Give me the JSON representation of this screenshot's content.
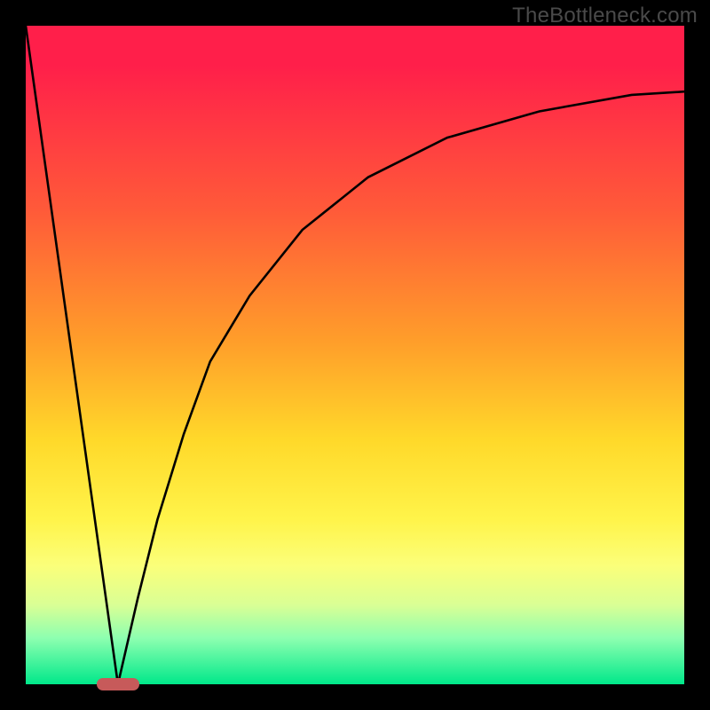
{
  "watermark": "TheBottleneck.com",
  "chart_data": {
    "type": "line",
    "title": "",
    "xlabel": "",
    "ylabel": "",
    "xlim": [
      0,
      100
    ],
    "ylim": [
      0,
      100
    ],
    "grid": false,
    "legend": false,
    "series": [
      {
        "name": "left-linear",
        "x": [
          0,
          14
        ],
        "values": [
          100,
          0
        ]
      },
      {
        "name": "right-curve",
        "x": [
          14,
          17,
          20,
          24,
          28,
          34,
          42,
          52,
          64,
          78,
          92,
          100
        ],
        "values": [
          0,
          13,
          25,
          38,
          49,
          59,
          69,
          77,
          83,
          87,
          89.5,
          90
        ]
      }
    ],
    "marker": {
      "x": 14,
      "y": 0,
      "color": "#c75a5a"
    },
    "gradient_stops": [
      {
        "pos": 0.0,
        "color": "#ff1f4a"
      },
      {
        "pos": 0.28,
        "color": "#ff5a39"
      },
      {
        "pos": 0.48,
        "color": "#ff9e2a"
      },
      {
        "pos": 0.63,
        "color": "#ffd92a"
      },
      {
        "pos": 0.82,
        "color": "#fbff7a"
      },
      {
        "pos": 1.0,
        "color": "#00e88a"
      }
    ]
  }
}
